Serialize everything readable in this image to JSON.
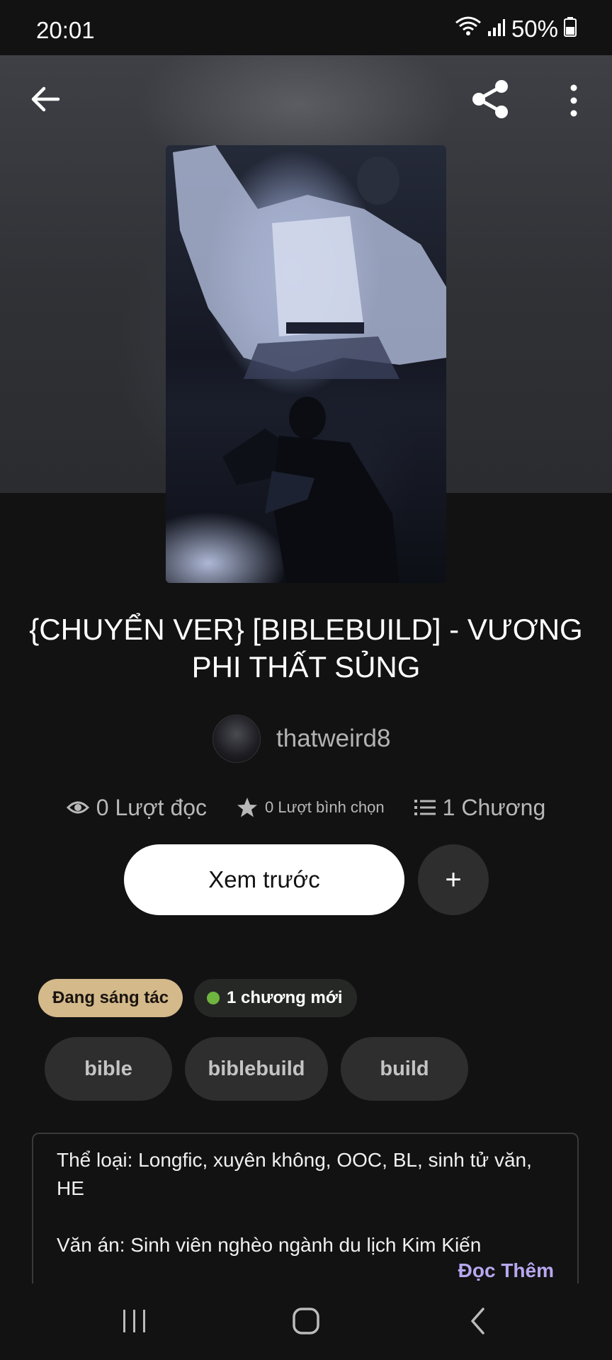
{
  "status_bar": {
    "time": "20:01",
    "battery": "50%",
    "icons": [
      "wifi-icon",
      "signal-icon",
      "battery-icon"
    ]
  },
  "header": {
    "back_icon": "arrow-left-icon",
    "share_icon": "share-icon",
    "more_icon": "more-vertical-icon"
  },
  "story": {
    "title": "{CHUYỂN VER} [BIBLEBUILD] - VƯƠNG PHI THẤT SỦNG",
    "author": "thatweird8",
    "stats": {
      "reads": "0 Lượt đọc",
      "votes": "0 Lượt bình chọn",
      "parts": "1 Chương"
    },
    "preview_label": "Xem trước",
    "add_label": "+",
    "status_chip": "Đang sáng tác",
    "new_chip": "1 chương mới",
    "tags": [
      "bible",
      "biblebuild",
      "build"
    ],
    "description": "Thể loại: Longfic, xuyên không, OOC, BL, sinh tử văn, HE\n\nVăn án: Sinh viên nghèo ngành du lịch Kim Kiến",
    "read_more": "Đọc Thêm"
  },
  "colors": {
    "background": "#121212",
    "status_chip": "#d4b98a",
    "new_dot": "#6fb53f",
    "read_more": "#b8a7ef"
  }
}
